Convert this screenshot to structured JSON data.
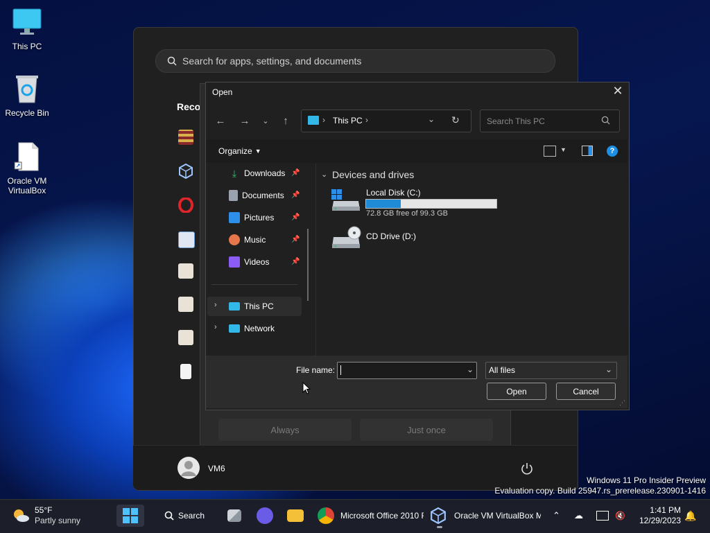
{
  "desktop": {
    "icons": [
      {
        "label": "This PC",
        "icon": "monitor-icon"
      },
      {
        "label": "Recycle Bin",
        "icon": "recycle-bin-icon"
      },
      {
        "label": "Oracle VM VirtualBox",
        "icon": "file-shortcut-icon"
      }
    ],
    "watermark": {
      "line1": "Windows 11 Pro Insider Preview",
      "line2": "Evaluation copy. Build 25947.rs_prerelease.230901-1416"
    }
  },
  "start_menu": {
    "search_placeholder": "Search for apps, settings, and documents",
    "recommended_label": "Reco",
    "user_name": "VM6",
    "power_icon": "power-icon"
  },
  "behind_dialog": {
    "always_label": "Always",
    "just_once_label": "Just once"
  },
  "open_dialog": {
    "title": "Open",
    "address": {
      "location": "This PC",
      "separator_before": "›",
      "separator_after": "›"
    },
    "search_placeholder": "Search This PC",
    "toolbar": {
      "organize_label": "Organize"
    },
    "nav_pane": {
      "quick_access": [
        {
          "label": "Downloads",
          "color": "#2fbf71"
        },
        {
          "label": "Documents",
          "color": "#9aa3ad"
        },
        {
          "label": "Pictures",
          "color": "#2d8fe8"
        },
        {
          "label": "Music",
          "color": "#e5774b"
        },
        {
          "label": "Videos",
          "color": "#8b5cf6"
        }
      ],
      "tree": [
        {
          "label": "This PC",
          "selected": true
        },
        {
          "label": "Network",
          "selected": false
        }
      ]
    },
    "section_title": "Devices and drives",
    "drives": [
      {
        "name": "Local Disk (C:)",
        "free_text": "72.8 GB free of 99.3 GB",
        "used_fraction": 0.267
      },
      {
        "name": "CD Drive (D:)"
      }
    ],
    "file_name_label": "File name:",
    "file_name_value": "",
    "file_type_value": "All files",
    "open_button": "Open",
    "cancel_button": "Cancel"
  },
  "taskbar": {
    "weather": {
      "temp": "55°F",
      "condition": "Partly sunny"
    },
    "search_label": "Search",
    "apps": [
      {
        "label": "Microsoft Office 2010 F",
        "icon": "chrome-icon"
      },
      {
        "label": "Oracle VM VirtualBox M",
        "icon": "virtualbox-icon"
      }
    ],
    "clock": {
      "time": "1:41 PM",
      "date": "12/29/2023"
    }
  }
}
